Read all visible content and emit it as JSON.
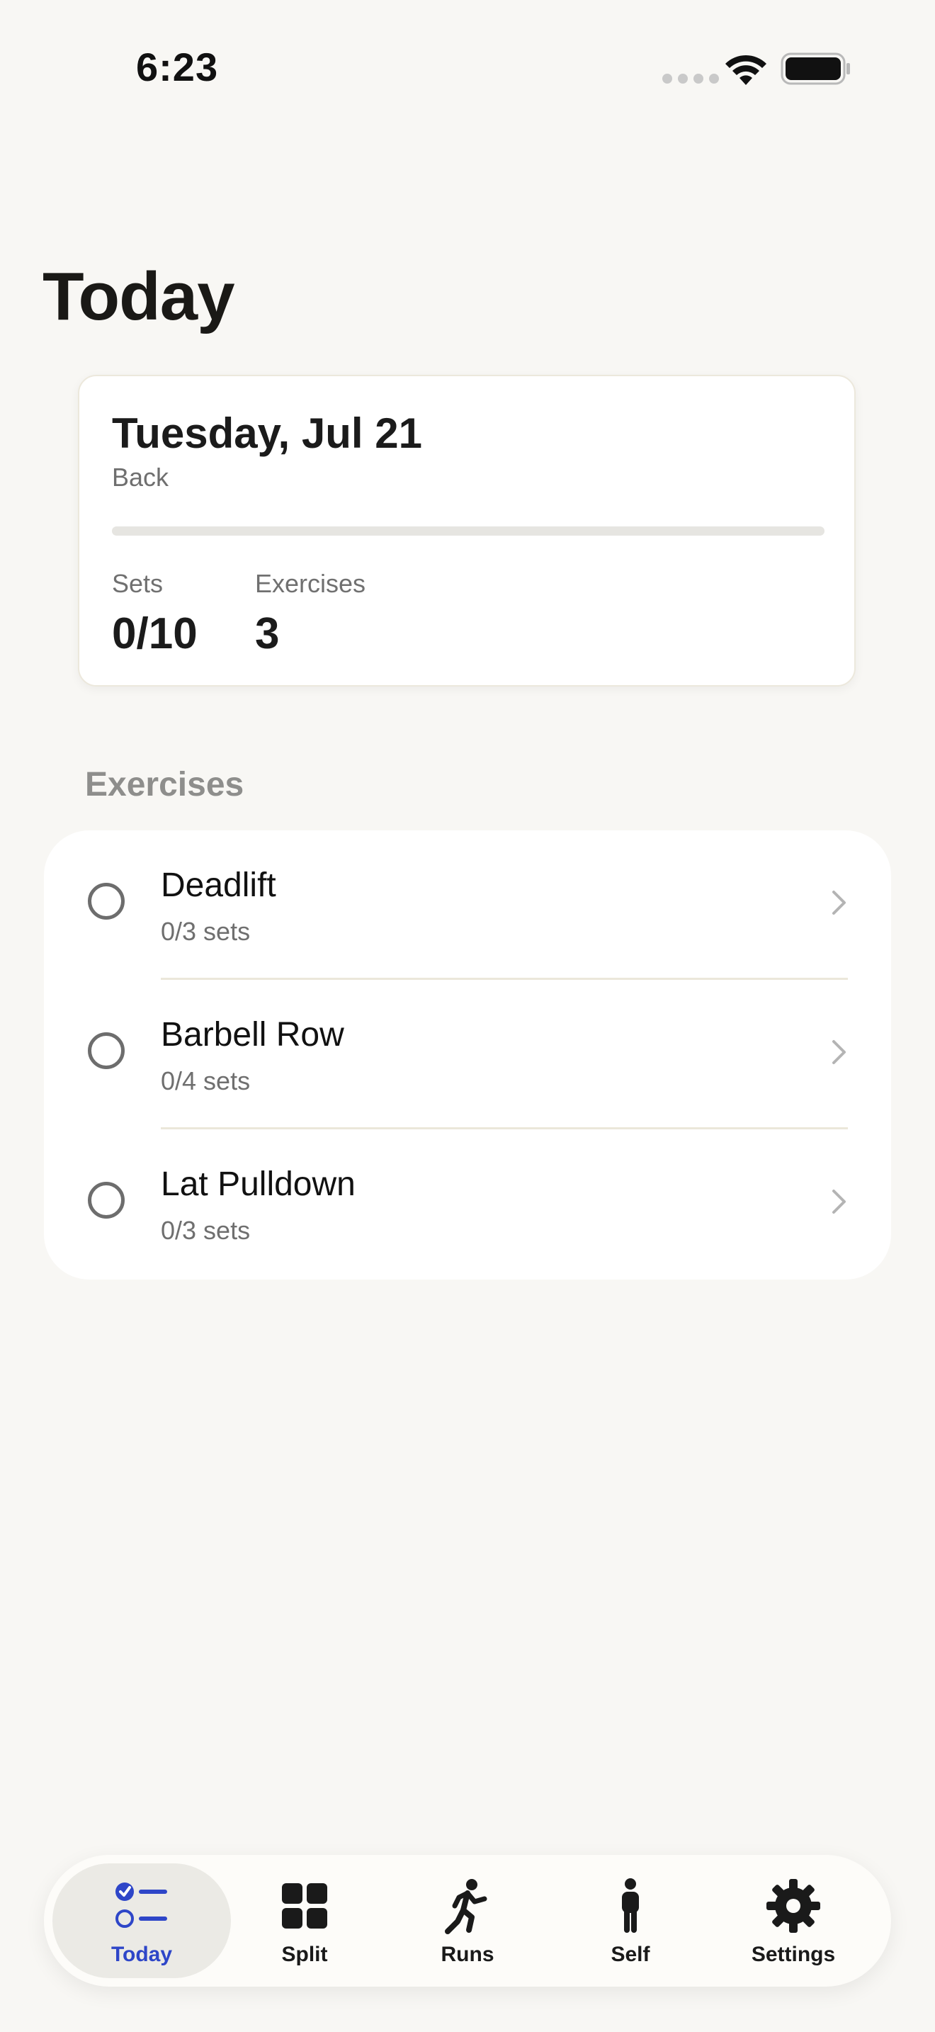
{
  "status_bar": {
    "time": "6:23"
  },
  "colors": {
    "accent": "#2e46c8",
    "background": "#f8f7f4",
    "card": "#ffffff"
  },
  "page": {
    "title": "Today"
  },
  "summary": {
    "date": "Tuesday, Jul 21",
    "split_name": "Back",
    "progress_fraction": 0,
    "stats": [
      {
        "label": "Sets",
        "value": "0/10"
      },
      {
        "label": "Exercises",
        "value": "3"
      }
    ]
  },
  "exercises_section": {
    "header": "Exercises",
    "items": [
      {
        "name": "Deadlift",
        "sets": "0/3 sets",
        "done": false
      },
      {
        "name": "Barbell Row",
        "sets": "0/4 sets",
        "done": false
      },
      {
        "name": "Lat Pulldown",
        "sets": "0/3 sets",
        "done": false
      }
    ]
  },
  "tab_bar": {
    "tabs": [
      {
        "label": "Today",
        "icon": "checklist-icon",
        "active": true
      },
      {
        "label": "Split",
        "icon": "grid-icon",
        "active": false
      },
      {
        "label": "Runs",
        "icon": "runner-icon",
        "active": false
      },
      {
        "label": "Self",
        "icon": "person-icon",
        "active": false
      },
      {
        "label": "Settings",
        "icon": "gear-icon",
        "active": false
      }
    ]
  }
}
